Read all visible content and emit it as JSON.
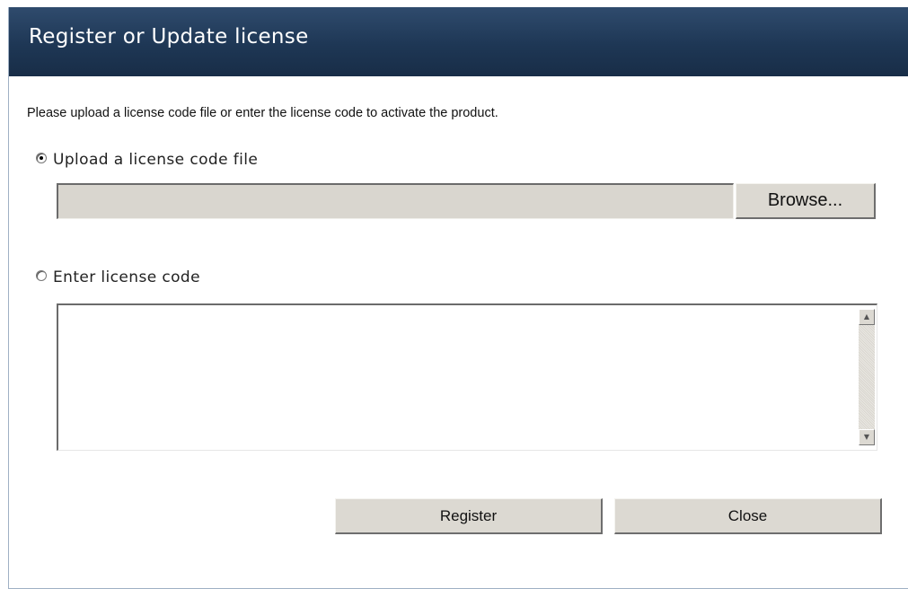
{
  "dialog": {
    "title": "Register or Update license",
    "intro": "Please upload a license code file or enter the license code to activate the product.",
    "options": {
      "upload": {
        "label": "Upload a license code file",
        "selected": true
      },
      "enter": {
        "label": "Enter license code",
        "selected": false
      }
    },
    "file_path": "",
    "browse_label": "Browse...",
    "license_code": "",
    "register_label": "Register",
    "close_label": "Close"
  }
}
